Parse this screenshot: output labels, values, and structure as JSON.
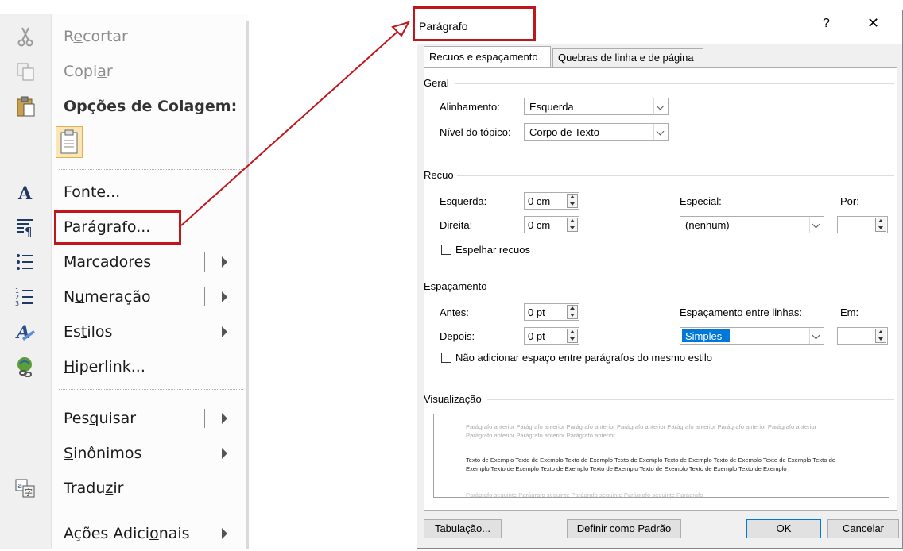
{
  "context_menu": {
    "items": [
      {
        "label": "Recortar",
        "u": "e",
        "icon": "scissors-icon",
        "disabled": true
      },
      {
        "label": "Copiar",
        "u": "a",
        "icon": "copy-icon",
        "disabled": true
      },
      {
        "label": "Opções de Colagem:",
        "icon": "paste-icon",
        "header": true
      },
      {
        "label": "Fonte...",
        "u": "n",
        "icon": "font-icon"
      },
      {
        "label": "Parágrafo...",
        "u": "P",
        "icon": "paragraph-icon"
      },
      {
        "label": "Marcadores",
        "u": "M",
        "icon": "bullets-icon",
        "submenu": true,
        "split": true
      },
      {
        "label": "Numeração",
        "u": "u",
        "icon": "numbering-icon",
        "submenu": true,
        "split": true
      },
      {
        "label": "Estilos",
        "u": "t",
        "icon": "styles-icon",
        "submenu": true
      },
      {
        "label": "Hiperlink...",
        "u": "H",
        "icon": "hyperlink-icon"
      },
      {
        "label": "Pesquisar",
        "u": "q",
        "submenu": true,
        "split": true
      },
      {
        "label": "Sinônimos",
        "u": "S",
        "submenu": true
      },
      {
        "label": "Traduzir",
        "u": "z",
        "icon": "translate-icon"
      },
      {
        "label": "Ações Adicionais",
        "u": "o",
        "submenu": true
      }
    ]
  },
  "dialog": {
    "title": "Parágrafo",
    "help": "?",
    "close": "✕",
    "tabs": [
      "Recuos e espaçamento",
      "Quebras de linha e de página"
    ],
    "general": {
      "group": "Geral",
      "alignment_label": "Alinhamento:",
      "alignment_value": "Esquerda",
      "outline_label": "Nível do tópico:",
      "outline_value": "Corpo de Texto"
    },
    "indent": {
      "group": "Recuo",
      "left_label": "Esquerda:",
      "left_value": "0 cm",
      "right_label": "Direita:",
      "right_value": "0 cm",
      "special_label": "Especial:",
      "special_value": "(nenhum)",
      "by_label": "Por:",
      "mirror_label": "Espelhar recuos"
    },
    "spacing": {
      "group": "Espaçamento",
      "before_label": "Antes:",
      "before_value": "0 pt",
      "after_label": "Depois:",
      "after_value": "0 pt",
      "line_label": "Espaçamento entre linhas:",
      "line_value": "Simples",
      "at_label": "Em:",
      "dont_add_label": "Não adicionar espaço entre parágrafos do mesmo estilo"
    },
    "preview": {
      "group": "Visualização",
      "prev_text": "Parágrafo anterior Parágrafo anterior Parágrafo anterior Parágrafo anterior Parágrafo anterior Parágrafo anterior Parágrafo anterior Parágrafo anterior Parágrafo anterior Parágrafo anterior",
      "sample_text": "Texto de Exemplo Texto de Exemplo Texto de Exemplo Texto de Exemplo Texto de Exemplo Texto de Exemplo Texto de Exemplo Texto de Exemplo Texto de Exemplo Texto de Exemplo Texto de Exemplo Texto de Exemplo Texto de Exemplo Texto de Exemplo",
      "next_text": "Parágrafo seguinte Parágrafo seguinte Parágrafo seguinte Parágrafo seguinte Parágrafo"
    },
    "buttons": {
      "tabs": "Tabulação...",
      "default": "Definir como Padrão",
      "ok": "OK",
      "cancel": "Cancelar"
    }
  },
  "colors": {
    "highlight": "#c0171c",
    "selection": "#0078d7"
  }
}
